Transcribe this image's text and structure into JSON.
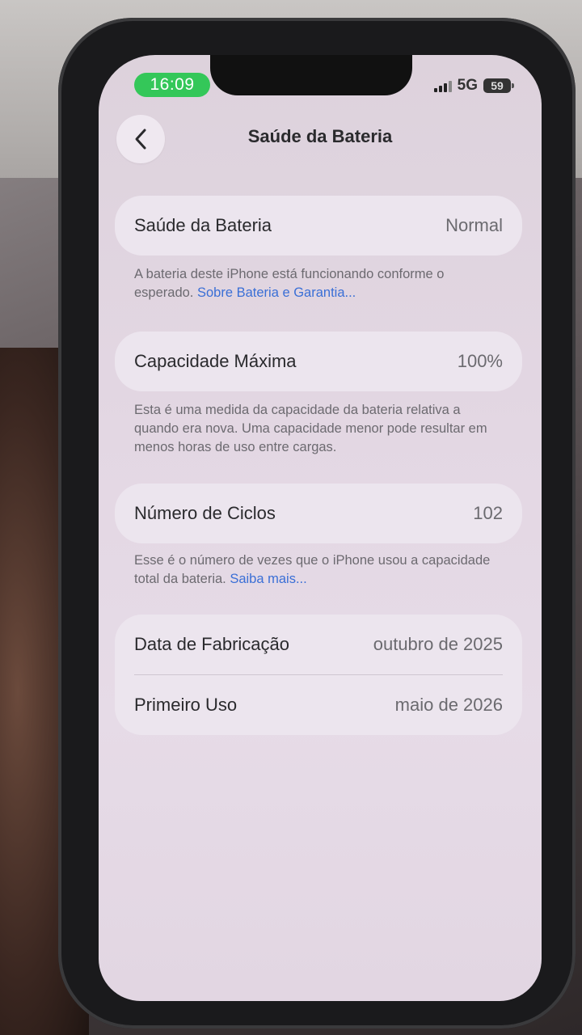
{
  "status_bar": {
    "time": "16:09",
    "network": "5G",
    "battery_level": "59"
  },
  "nav": {
    "title": "Saúde da Bateria"
  },
  "battery_health": {
    "label": "Saúde da Bateria",
    "value": "Normal",
    "footer_text": "A bateria deste iPhone está funcionando conforme o esperado. ",
    "footer_link": "Sobre Bateria e Garantia..."
  },
  "max_capacity": {
    "label": "Capacidade Máxima",
    "value": "100%",
    "footer_text": "Esta é uma medida da capacidade da bateria relativa a quando era nova. Uma capacidade menor pode resultar em menos horas de uso entre cargas."
  },
  "cycle_count": {
    "label": "Número de Ciclos",
    "value": "102",
    "footer_text": "Esse é o número de vezes que o iPhone usou a capacidade total da bateria. ",
    "footer_link": "Saiba mais..."
  },
  "dates": {
    "manufacture_label": "Data de Fabricação",
    "manufacture_value": "outubro de 2025",
    "first_use_label": "Primeiro Uso",
    "first_use_value": "maio de 2026"
  },
  "colors": {
    "time_pill": "#34c759",
    "link": "#3a6fd6",
    "screen_bg": "#e3d7e3",
    "card_bg": "#ece5ee"
  },
  "icons": {
    "back": "chevron-left-icon",
    "signal": "cellular-signal-icon",
    "battery": "battery-icon"
  }
}
